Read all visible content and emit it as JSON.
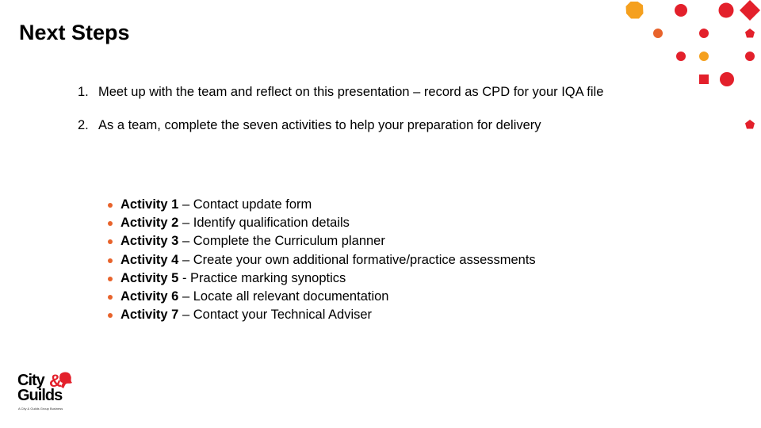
{
  "slide": {
    "title": "Next Steps",
    "numbered_items": [
      {
        "number": "1.",
        "text": "Meet up with the team and reflect on this presentation – record as CPD for your IQA file"
      },
      {
        "number": "2.",
        "text": "As a team, complete the seven activities to help your preparation for delivery"
      }
    ],
    "activities": [
      {
        "label": "Activity 1",
        "separator": " – ",
        "text": "Contact update form"
      },
      {
        "label": "Activity 2",
        "separator": " – ",
        "text": "Identify qualification details"
      },
      {
        "label": "Activity 3",
        "separator": " – ",
        "text": "Complete the Curriculum planner"
      },
      {
        "label": "Activity 4",
        "separator": " – ",
        "text": "Create your own additional formative/practice assessments"
      },
      {
        "label": "Activity 5",
        "separator": " - ",
        "text": "Practice marking synoptics"
      },
      {
        "label": "Activity 6",
        "separator": " – ",
        "text": "Locate all relevant documentation"
      },
      {
        "label": "Activity 7",
        "separator": " – ",
        "text": "Contact your Technical Adviser"
      }
    ],
    "bullet_color": "#E8632B"
  },
  "logo": {
    "line1": "City",
    "ampersand": "&",
    "line2": "Guilds",
    "tagline": "A City & Guilds Group Business",
    "accent_color": "#E3202B"
  },
  "decoration": {
    "colors": {
      "red": "#E3202B",
      "orange": "#F5A01E",
      "orange_red": "#E8632B"
    }
  }
}
